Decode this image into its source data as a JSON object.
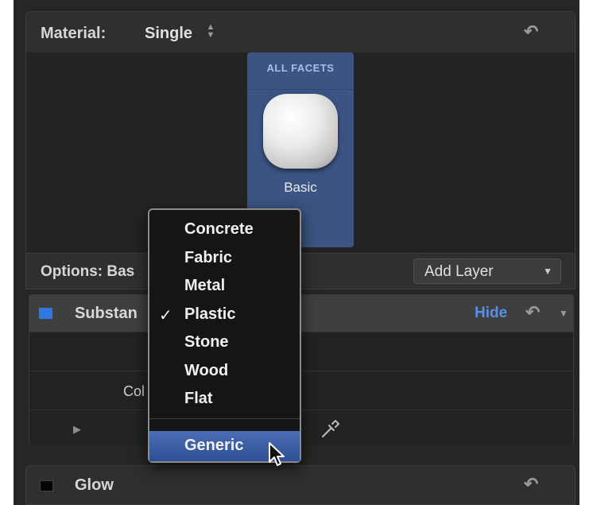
{
  "material": {
    "label": "Material:",
    "value": "Single"
  },
  "facet": {
    "title": "ALL FACETS",
    "label": "Basic"
  },
  "options": {
    "label": "Options: Bas",
    "add_layer": "Add Layer"
  },
  "substance": {
    "label": "Substan",
    "hide": "Hide",
    "color_label": "Col"
  },
  "glow": {
    "label": "Glow"
  },
  "menu": {
    "items": [
      "Concrete",
      "Fabric",
      "Metal",
      "Plastic",
      "Stone",
      "Wood",
      "Flat"
    ],
    "checked": "Plastic",
    "highlighted": "Generic"
  },
  "colors": {
    "accent": "#3b5483",
    "hide_link": "#5a8fe6",
    "substance_swatch": "#2f78e0",
    "menu_highlight": "#2d4f93"
  },
  "icons": {
    "undo": "undo-arrow-icon",
    "stepper": "up-down-stepper-icon",
    "dropdown": "triangle-down-icon",
    "disclosure": "disclosure-triangle-icon",
    "eyedropper": "eyedropper-icon",
    "cursor": "pointer-cursor-icon"
  }
}
